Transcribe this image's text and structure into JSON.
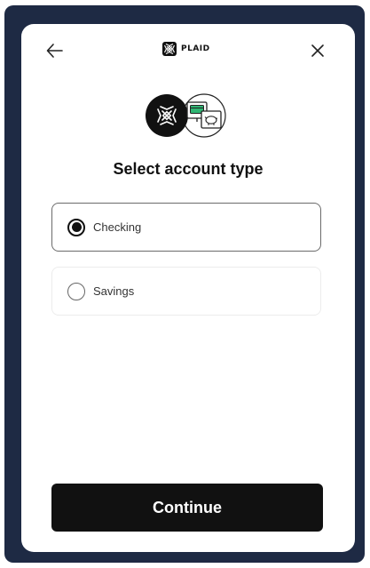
{
  "header": {
    "back_icon": "arrow-left-icon",
    "close_icon": "close-icon",
    "logo_icon": "plaid-logo-icon",
    "logo_text": "PLAID"
  },
  "hero": {
    "icons": [
      "plaid-logo-icon",
      "credit-card-icon",
      "piggy-bank-icon"
    ]
  },
  "title": "Select account type",
  "options": [
    {
      "label": "Checking",
      "selected": true
    },
    {
      "label": "Savings",
      "selected": false
    }
  ],
  "continue_label": "Continue",
  "colors": {
    "frame": "#1e2a44",
    "button": "#111111",
    "card_icon": "#2fb673"
  }
}
